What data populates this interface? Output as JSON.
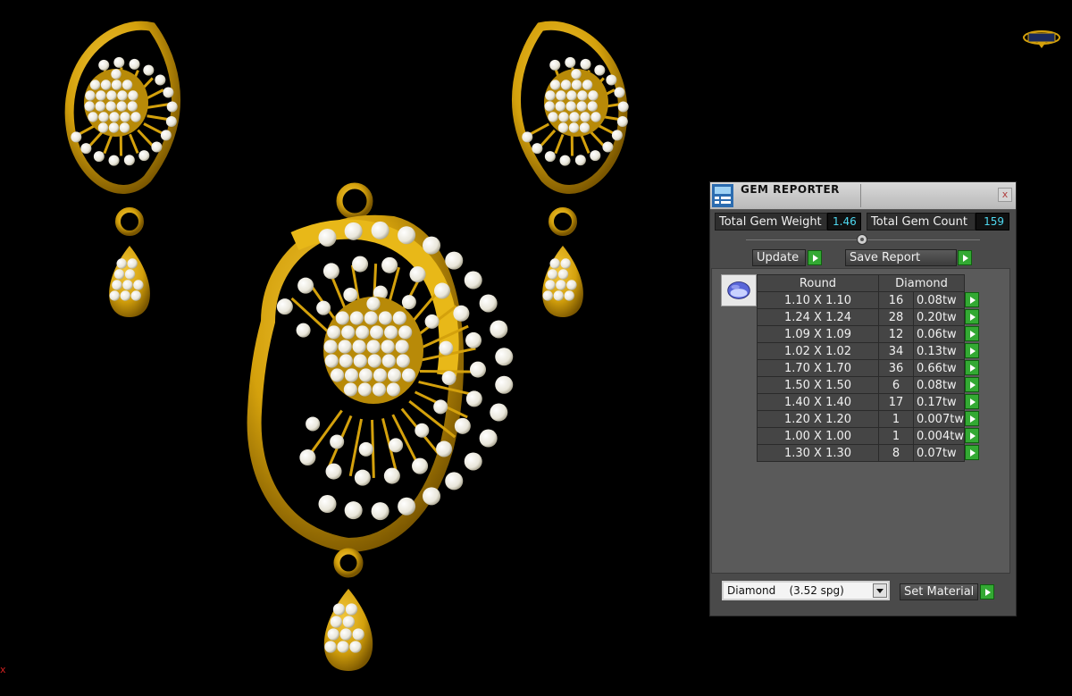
{
  "viewport": {
    "metal_color": "#d4a10c",
    "gem_color": "#f2f2ec",
    "background": "#000000"
  },
  "gem_reporter": {
    "title": "GEM REPORTER",
    "close_symbol": "x",
    "total_gem_weight_label": "Total Gem Weight",
    "total_gem_weight_value": "1.46",
    "total_gem_count_label": "Total Gem Count",
    "total_gem_count_value": "159",
    "update_label": "Update",
    "save_report_label": "Save Report",
    "columns": {
      "shape": "Round",
      "material": "Diamond"
    },
    "rows": [
      {
        "size": "1.10 X 1.10",
        "count": "16",
        "weight": "0.08tw"
      },
      {
        "size": "1.24 X 1.24",
        "count": "28",
        "weight": "0.20tw"
      },
      {
        "size": "1.09 X 1.09",
        "count": "12",
        "weight": "0.06tw"
      },
      {
        "size": "1.02 X 1.02",
        "count": "34",
        "weight": "0.13tw"
      },
      {
        "size": "1.70 X 1.70",
        "count": "36",
        "weight": "0.66tw"
      },
      {
        "size": "1.50 X 1.50",
        "count": "6",
        "weight": "0.08tw"
      },
      {
        "size": "1.40 X 1.40",
        "count": "17",
        "weight": "0.17tw"
      },
      {
        "size": "1.20 X 1.20",
        "count": "1",
        "weight": "0.007tw"
      },
      {
        "size": "1.00 X 1.00",
        "count": "1",
        "weight": "0.004tw"
      },
      {
        "size": "1.30 X 1.30",
        "count": "8",
        "weight": "0.07tw"
      }
    ],
    "material_select": {
      "name": "Diamond",
      "density": "(3.52 spg)"
    },
    "set_material_label": "Set Material",
    "accent_color": "#33a933",
    "value_color": "#4ed8f0"
  },
  "corner_marker": "x"
}
